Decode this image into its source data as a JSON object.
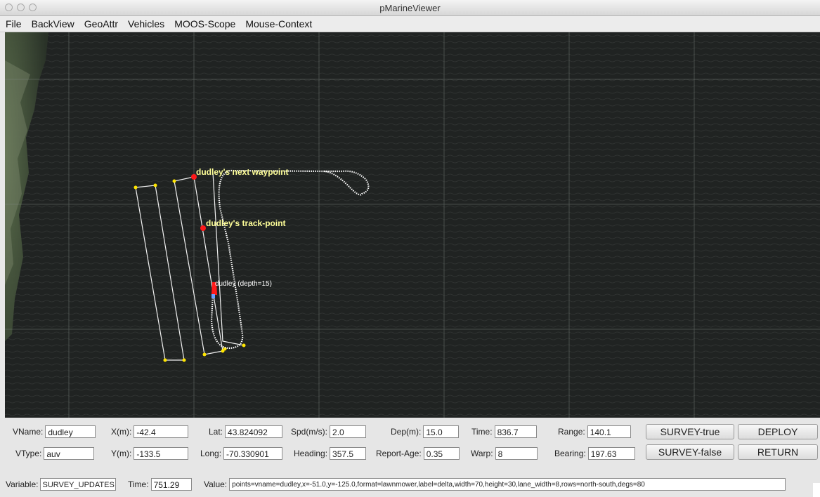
{
  "window": {
    "title": "pMarineViewer"
  },
  "menu": [
    "File",
    "BackView",
    "GeoAttr",
    "Vehicles",
    "MOOS-Scope",
    "Mouse-Context"
  ],
  "map": {
    "labels": {
      "next_waypoint": "dudley's next waypoint",
      "track_point": "dudley's track-point",
      "vehicle": "dudley (depth=15)"
    },
    "colors": {
      "label_yellow": "#ffff99",
      "vertex_yellow": "#ffe600",
      "marker_red": "#ff1a1a",
      "trail_white": "#ffffff"
    }
  },
  "fields": {
    "vname": {
      "label": "VName:",
      "value": "dudley"
    },
    "vtype": {
      "label": "VType:",
      "value": "auv"
    },
    "x": {
      "label": "X(m):",
      "value": "-42.4"
    },
    "y": {
      "label": "Y(m):",
      "value": "-133.5"
    },
    "lat": {
      "label": "Lat:",
      "value": "43.824092"
    },
    "long": {
      "label": "Long:",
      "value": "-70.330901"
    },
    "spd": {
      "label": "Spd(m/s):",
      "value": "2.0"
    },
    "heading": {
      "label": "Heading:",
      "value": "357.5"
    },
    "dep": {
      "label": "Dep(m):",
      "value": "15.0"
    },
    "report_age": {
      "label": "Report-Age:",
      "value": "0.35"
    },
    "time": {
      "label": "Time:",
      "value": "836.7"
    },
    "warp": {
      "label": "Warp:",
      "value": "8"
    },
    "range": {
      "label": "Range:",
      "value": "140.1"
    },
    "bearing": {
      "label": "Bearing:",
      "value": "197.63"
    }
  },
  "buttons": {
    "survey_true": "SURVEY-true",
    "survey_false": "SURVEY-false",
    "deploy": "DEPLOY",
    "return": "RETURN"
  },
  "scope": {
    "variable_label": "Variable:",
    "variable_value": "SURVEY_UPDATES",
    "time_label": "Time:",
    "time_value": "751.29",
    "value_label": "Value:",
    "value_value": "points=vname=dudley,x=-51.0,y=-125.0,format=lawnmower,label=delta,width=70,height=30,lane_width=8,rows=north-south,degs=80"
  }
}
